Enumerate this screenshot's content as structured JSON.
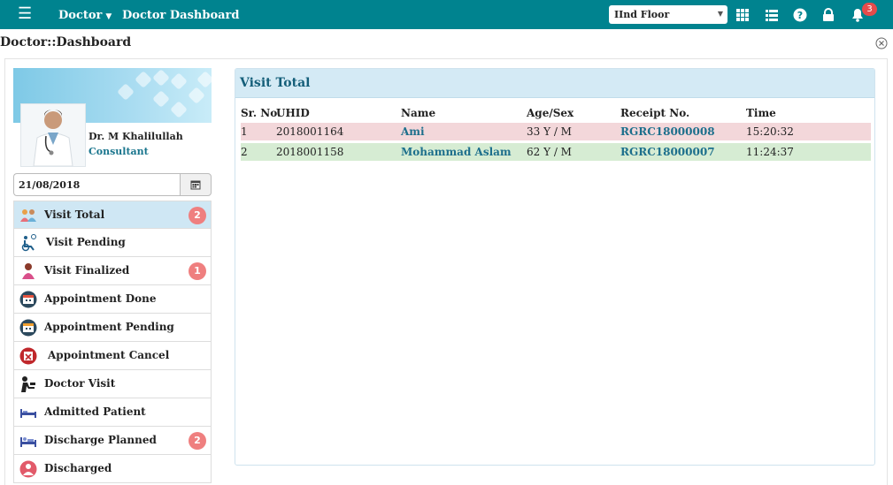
{
  "topbar": {
    "menu_label": "Doctor",
    "title": "Doctor Dashboard",
    "floor_selected": "IInd Floor",
    "notification_count": "3",
    "bg_color": "#00838f"
  },
  "page": {
    "title": "Doctor::Dashboard"
  },
  "doctor": {
    "name": "Dr. M Khalilullah",
    "role": "Consultant"
  },
  "date_filter": {
    "value": "21/08/2018"
  },
  "nav": [
    {
      "label": "Visit Total",
      "badge": "2",
      "icon": "group-icon",
      "active": true
    },
    {
      "label": "Visit Pending",
      "badge": "",
      "icon": "wheelchair-icon"
    },
    {
      "label": "Visit Finalized",
      "badge": "1",
      "icon": "patient-icon"
    },
    {
      "label": "Appointment Done",
      "badge": "",
      "icon": "calendar-check-icon"
    },
    {
      "label": "Appointment Pending",
      "badge": "",
      "icon": "calendar-pending-icon"
    },
    {
      "label": "Appointment Cancel",
      "badge": "",
      "icon": "calendar-cancel-icon"
    },
    {
      "label": "Doctor Visit",
      "badge": "",
      "icon": "doctor-visit-icon"
    },
    {
      "label": "Admitted Patient",
      "badge": "",
      "icon": "bed-icon"
    },
    {
      "label": "Discharge Planned",
      "badge": "2",
      "icon": "bed-planned-icon"
    },
    {
      "label": "Discharged",
      "badge": "",
      "icon": "discharged-icon"
    }
  ],
  "panel": {
    "title": "Visit Total",
    "columns": [
      "Sr. No.",
      "UHID",
      "Name",
      "Age/Sex",
      "Receipt No.",
      "Time"
    ],
    "rows": [
      {
        "sr": "1",
        "uhid": "2018001164",
        "name": "Ami",
        "age_sex": "33 Y / M",
        "receipt": "RGRC18000008",
        "time": "15:20:32"
      },
      {
        "sr": "2",
        "uhid": "2018001158",
        "name": "Mohammad Aslam",
        "age_sex": "62 Y / M",
        "receipt": "RGRC18000007",
        "time": "11:24:37"
      }
    ]
  }
}
